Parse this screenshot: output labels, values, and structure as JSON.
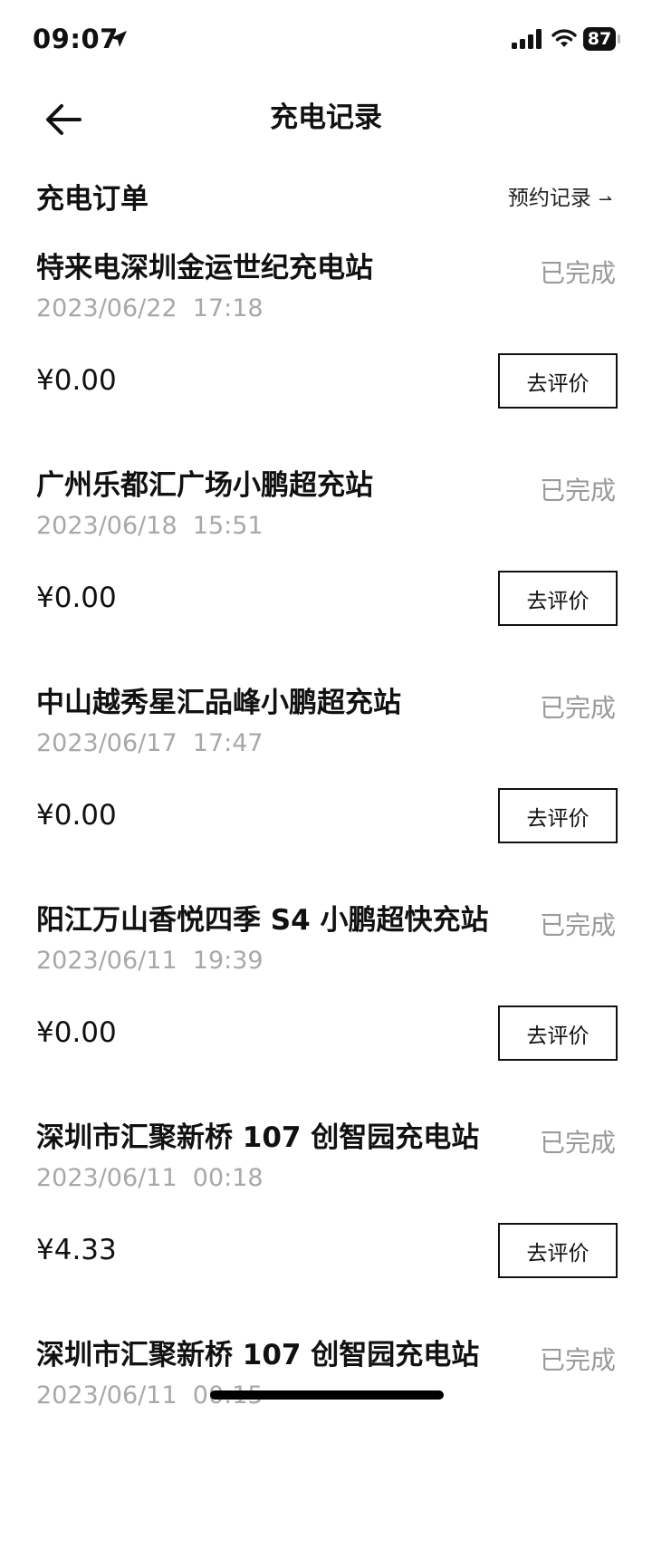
{
  "status_bar": {
    "time": "09:07",
    "battery": "87"
  },
  "header": {
    "title": "充电记录"
  },
  "section": {
    "title": "充电订单",
    "reservation_link": "预约记录",
    "reservation_arrow": "⌐"
  },
  "orders": [
    {
      "station": "特来电深圳金运世纪充电站",
      "time": "2023/06/22  17:18",
      "status": "已完成",
      "amount": "¥0.00",
      "action": "去评价"
    },
    {
      "station": "广州乐都汇广场小鹏超充站",
      "time": "2023/06/18  15:51",
      "status": "已完成",
      "amount": "¥0.00",
      "action": "去评价"
    },
    {
      "station": "中山越秀星汇品峰小鹏超充站",
      "time": "2023/06/17  17:47",
      "status": "已完成",
      "amount": "¥0.00",
      "action": "去评价"
    },
    {
      "station": "阳江万山香悦四季 S4 小鹏超快充站",
      "time": "2023/06/11  19:39",
      "status": "已完成",
      "amount": "¥0.00",
      "action": "去评价"
    },
    {
      "station": "深圳市汇聚新桥 107 创智园充电站",
      "time": "2023/06/11  00:18",
      "status": "已完成",
      "amount": "¥4.33",
      "action": "去评价"
    },
    {
      "station": "深圳市汇聚新桥 107 创智园充电站",
      "time": "2023/06/11  00:15",
      "status": "已完成",
      "amount": "",
      "action": ""
    }
  ]
}
